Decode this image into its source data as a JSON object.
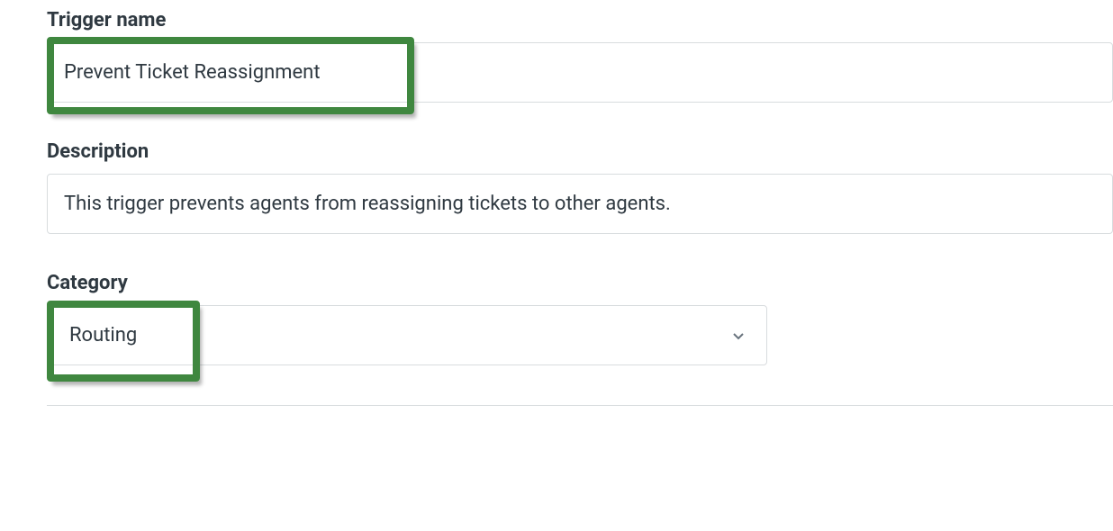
{
  "trigger_name": {
    "label": "Trigger name",
    "value": "Prevent Ticket Reassignment"
  },
  "description": {
    "label": "Description",
    "value": "This trigger prevents agents from reassigning tickets to other agents."
  },
  "category": {
    "label": "Category",
    "value": "Routing"
  }
}
